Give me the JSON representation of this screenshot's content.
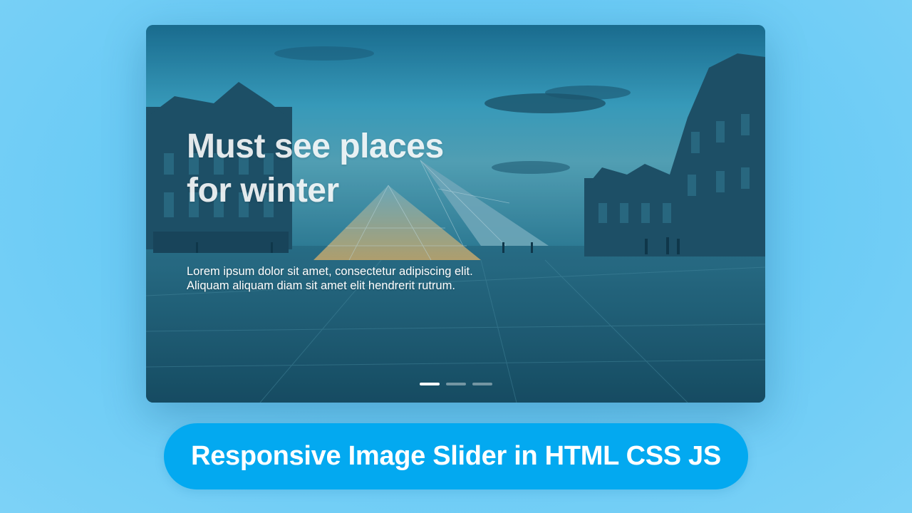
{
  "slider": {
    "title": "Must see places\nfor winter",
    "description": "Lorem ipsum dolor sit amet, consectetur adipiscing elit.\nAliquam aliquam diam sit amet elit hendrerit rutrum.",
    "image_subject": "louvre-pyramid-courtyard",
    "active_slide": 1,
    "slide_count": 3
  },
  "caption": {
    "text": "Responsive Image Slider in HTML CSS JS"
  },
  "colors": {
    "page_background": "#6bcbf5",
    "caption_pill": "#03a9f0",
    "caption_text": "#ffffff",
    "dot_active": "#ffffff"
  }
}
